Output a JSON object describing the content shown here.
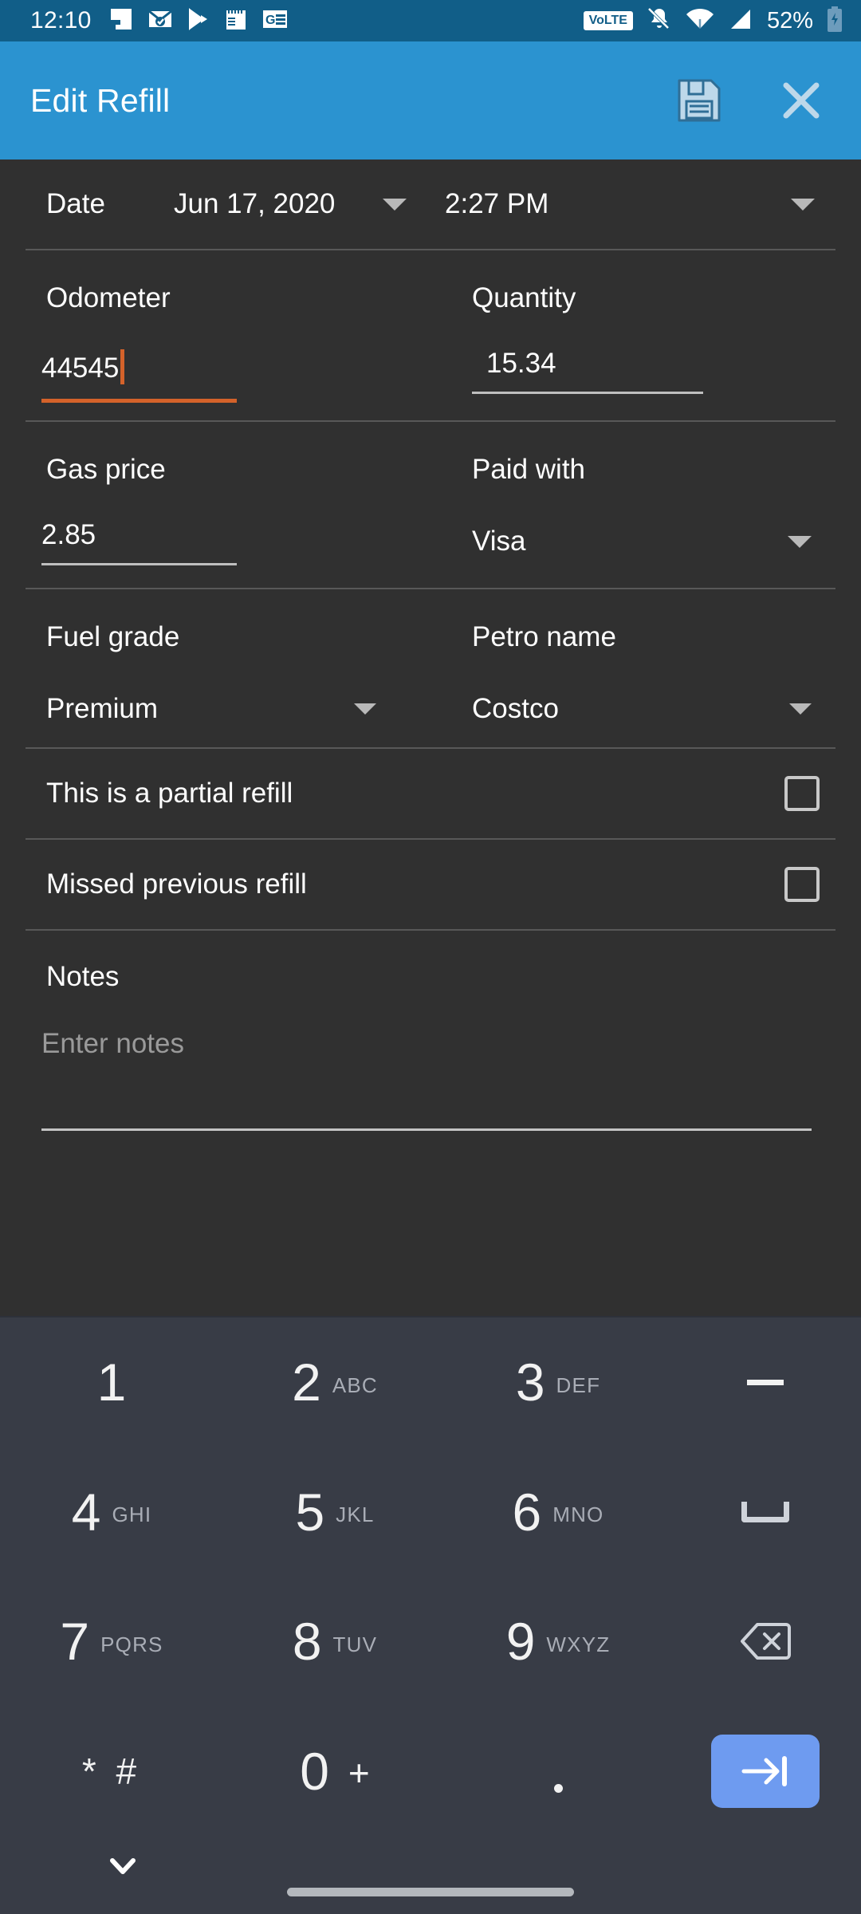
{
  "status_bar": {
    "time": "12:10",
    "battery_percent": "52%",
    "volte_label": "VoLTE",
    "notification_icons": [
      "flipboard-icon",
      "email-icon",
      "play-store-icon",
      "notepad-icon",
      "google-news-icon"
    ],
    "right_icons": [
      "volte-icon",
      "notifications-muted-icon",
      "wifi-icon",
      "cellular-signal-icon",
      "battery-charging-icon"
    ],
    "background_color": "#115e88"
  },
  "app_bar": {
    "title": "Edit Refill",
    "save_icon": "save-floppy-icon",
    "close_icon": "close-x-icon",
    "background_color": "#2b93d0",
    "icon_color": "#bdd8ea"
  },
  "form": {
    "date_row": {
      "label": "Date",
      "date_value": "Jun 17, 2020",
      "time_value": "2:27 PM"
    },
    "odometer": {
      "label": "Odometer",
      "value": "44545",
      "focused": true,
      "accent_color": "#d4622a"
    },
    "quantity": {
      "label": "Quantity",
      "value": "15.34"
    },
    "gas_price": {
      "label": "Gas price",
      "value": "2.85"
    },
    "paid_with": {
      "label": "Paid with",
      "value": "Visa"
    },
    "fuel_grade": {
      "label": "Fuel grade",
      "value": "Premium"
    },
    "petro_name": {
      "label": "Petro name",
      "value": "Costco"
    },
    "partial_refill": {
      "label": "This is a partial refill",
      "checked": false
    },
    "missed_refill": {
      "label": "Missed previous refill",
      "checked": false
    },
    "notes": {
      "label": "Notes",
      "placeholder": "Enter notes",
      "value": ""
    },
    "background_color": "#303030"
  },
  "keyboard": {
    "type": "numeric-phone-pad",
    "background_color": "#383c46",
    "enter_key_color": "#6e9bf0",
    "keys": [
      {
        "digit": "1",
        "letters": ""
      },
      {
        "digit": "2",
        "letters": "ABC"
      },
      {
        "digit": "3",
        "letters": "DEF"
      },
      {
        "digit": "4",
        "letters": "GHI"
      },
      {
        "digit": "5",
        "letters": "JKL"
      },
      {
        "digit": "6",
        "letters": "MNO"
      },
      {
        "digit": "7",
        "letters": "PQRS"
      },
      {
        "digit": "8",
        "letters": "TUV"
      },
      {
        "digit": "9",
        "letters": "WXYZ"
      },
      {
        "digit": "0",
        "letters": "+"
      }
    ],
    "star_hash": "* #",
    "period": ".",
    "side_keys": [
      "minus-key",
      "space-key",
      "backspace-key",
      "enter-tab-key"
    ],
    "hide_keyboard_icon": "chevron-down-icon"
  }
}
